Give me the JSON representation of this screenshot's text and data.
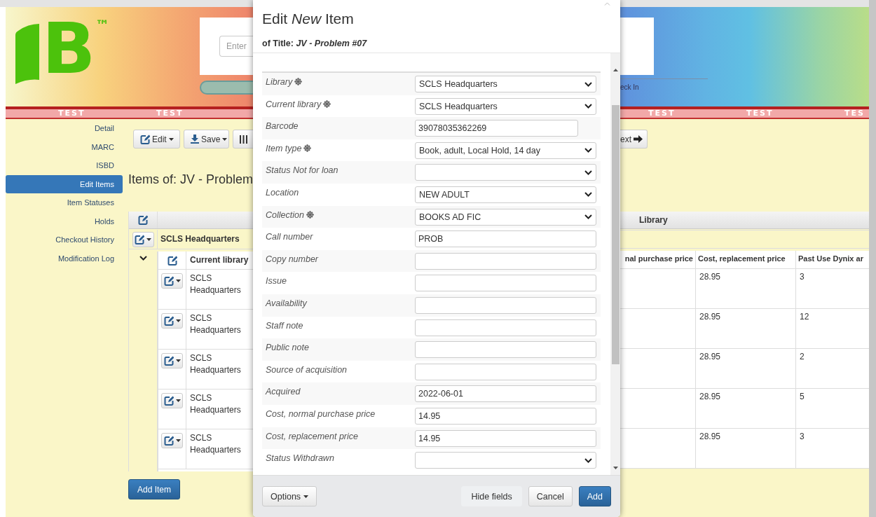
{
  "header": {
    "logo": {
      "letter": "B",
      "mark": "™"
    },
    "search_placeholder": "Enter",
    "checkin_link": "eck In"
  },
  "test_banner": {
    "left": [
      "TEST",
      "TEST"
    ],
    "right": [
      "TEST",
      "TEST",
      "TES"
    ]
  },
  "sidebar": [
    {
      "label": "Detail",
      "selected": false
    },
    {
      "label": "MARC",
      "selected": false
    },
    {
      "label": "ISBD",
      "selected": false
    },
    {
      "label": "Edit Items",
      "selected": true
    },
    {
      "label": "Item Statuses",
      "selected": false
    },
    {
      "label": "Holds",
      "selected": false
    },
    {
      "label": "Checkout History",
      "selected": false
    },
    {
      "label": "Modification Log",
      "selected": false
    }
  ],
  "toolbar": {
    "left": [
      {
        "kind": "edit",
        "label": "Edit"
      },
      {
        "kind": "save",
        "label": "Save"
      },
      {
        "kind": "columns"
      }
    ],
    "right": [
      {
        "kind": "next",
        "label": "ext"
      }
    ]
  },
  "heading": "Items of: JV - Problem",
  "items_table": {
    "group_column": "Library",
    "group": "SCLS Headquarters",
    "columns_left": [
      "Current library"
    ],
    "columns_right": [
      "nal purchase price",
      "Cost, replacement price",
      "Past Use Dynix ar"
    ],
    "rows": [
      {
        "current_library": "SCLS Headquarters",
        "cost_replacement_price": "28.95",
        "past_use": "3"
      },
      {
        "current_library": "SCLS Headquarters",
        "cost_replacement_price": "28.95",
        "past_use": "12"
      },
      {
        "current_library": "SCLS Headquarters",
        "cost_replacement_price": "28.95",
        "past_use": "2"
      },
      {
        "current_library": "SCLS Headquarters",
        "cost_replacement_price": "28.95",
        "past_use": "5"
      },
      {
        "current_library": "SCLS Headquarters",
        "cost_replacement_price": "28.95",
        "past_use": "3"
      }
    ]
  },
  "add_item_button": "Add Item",
  "modal": {
    "title": "Edit *New* Item",
    "subtitle": "of Title: *JV - Problem #07*",
    "fields": [
      {
        "label": "Library",
        "required": true,
        "kind": "select",
        "value": "SCLS Headquarters"
      },
      {
        "label": "Current library",
        "required": true,
        "kind": "select",
        "value": "SCLS Headquarters"
      },
      {
        "label": "Barcode",
        "required": false,
        "kind": "short_input",
        "value": "39078035362269"
      },
      {
        "label": "Item type",
        "required": true,
        "kind": "select",
        "value": "Book, adult, Local Hold, 14 day"
      },
      {
        "label": "Status Not for loan",
        "required": false,
        "kind": "select"
      },
      {
        "label": "Location",
        "required": false,
        "kind": "select",
        "value": "NEW ADULT"
      },
      {
        "label": "Collection",
        "required": true,
        "kind": "select",
        "value": "BOOKS AD FIC"
      },
      {
        "label": "Call number",
        "required": false,
        "kind": "input",
        "value": "PROB"
      },
      {
        "label": "Copy number",
        "required": false,
        "kind": "input"
      },
      {
        "label": "Issue",
        "required": false,
        "kind": "input"
      },
      {
        "label": "Availability",
        "required": false,
        "kind": "input"
      },
      {
        "label": "Staff note",
        "required": false,
        "kind": "input"
      },
      {
        "label": "Public note",
        "required": false,
        "kind": "input"
      },
      {
        "label": "Source of acquisition",
        "required": false,
        "kind": "input"
      },
      {
        "label": "Acquired",
        "required": false,
        "kind": "input",
        "value": "2022-06-01"
      },
      {
        "label": "Cost, normal purchase price",
        "required": false,
        "kind": "input",
        "value": "14.95"
      },
      {
        "label": "Cost, replacement price",
        "required": false,
        "kind": "input",
        "value": "14.95"
      },
      {
        "label": "Status Withdrawn",
        "required": false,
        "kind": "select"
      }
    ],
    "options_button": "Options",
    "buttons": [
      {
        "label": "Hide fields",
        "kind": "plain"
      },
      {
        "label": "Cancel",
        "kind": "default"
      },
      {
        "label": "Add",
        "kind": "primary"
      }
    ]
  }
}
